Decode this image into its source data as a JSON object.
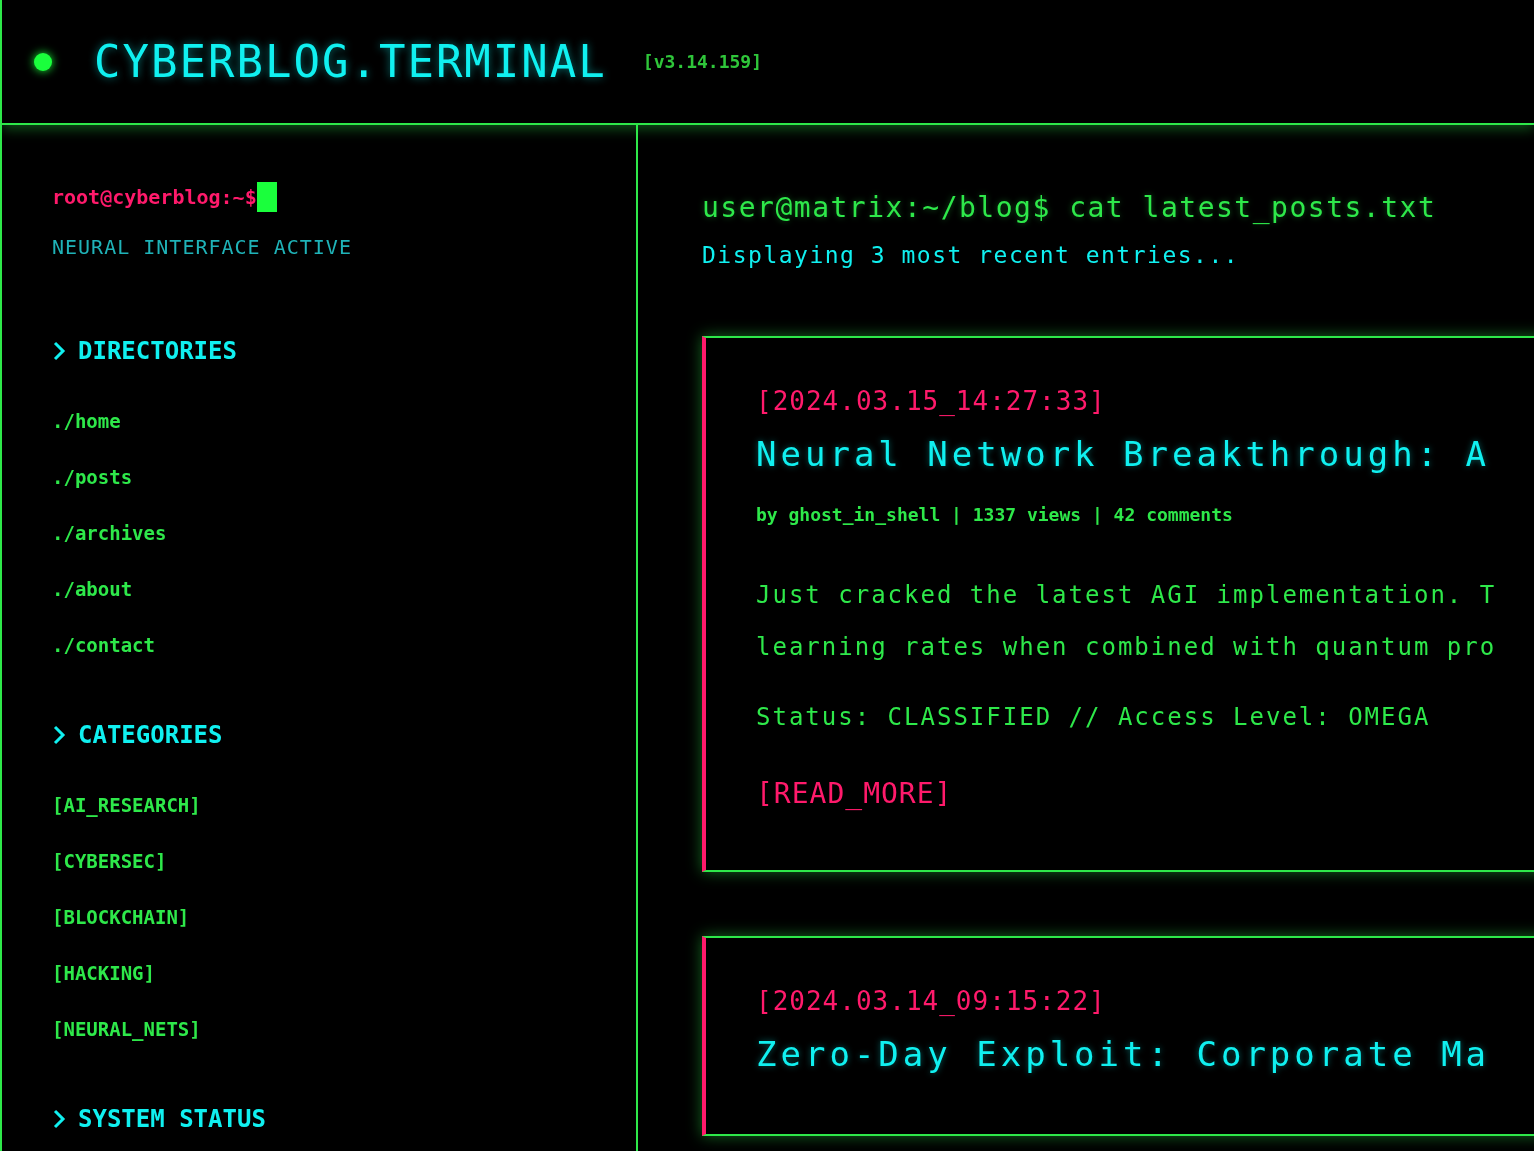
{
  "header": {
    "title": "CYBERBLOG.TERMINAL",
    "version": "[v3.14.159]",
    "online": true
  },
  "sidebar": {
    "prompt": "root@cyberblog:~$",
    "status": "NEURAL INTERFACE ACTIVE",
    "sections": [
      {
        "heading": "DIRECTORIES",
        "items": [
          "./home",
          "./posts",
          "./archives",
          "./about",
          "./contact"
        ]
      },
      {
        "heading": "CATEGORIES",
        "items": [
          "[AI_RESEARCH]",
          "[CYBERSEC]",
          "[BLOCKCHAIN]",
          "[HACKING]",
          "[NEURAL_NETS]"
        ]
      },
      {
        "heading": "SYSTEM STATUS"
      }
    ]
  },
  "main": {
    "command": "user@matrix:~/blog$ cat latest_posts.txt",
    "subtitle": "Displaying 3 most recent entries...",
    "posts": [
      {
        "timestamp": "[2024.03.15_14:27:33]",
        "title": "Neural Network Breakthrough: A",
        "meta": "by ghost_in_shell | 1337 views | 42 comments",
        "body_lines": [
          "Just cracked the latest AGI implementation. T",
          "learning rates when combined with quantum pro"
        ],
        "status": "Status: CLASSIFIED // Access Level: OMEGA",
        "link": "[READ_MORE]"
      },
      {
        "timestamp": "[2024.03.14_09:15:22]",
        "title": "Zero-Day Exploit: Corporate Ma"
      }
    ]
  }
}
